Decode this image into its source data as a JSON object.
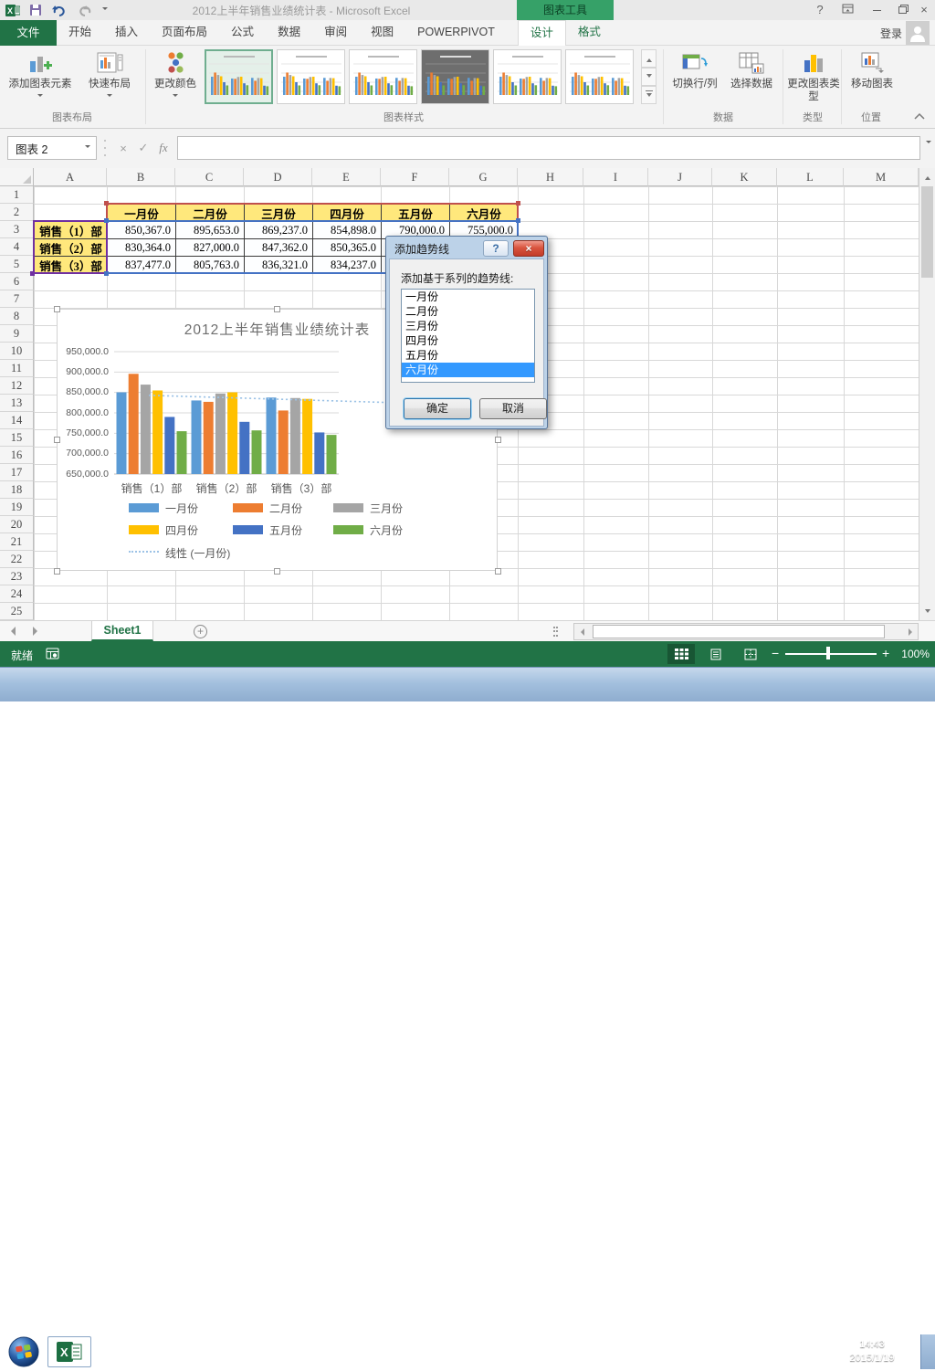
{
  "window": {
    "title": "2012上半年销售业绩统计表 - Microsoft Excel",
    "context_group": "图表工具",
    "sign_in": "登录",
    "help_glyph": "?",
    "close_glyph": "×"
  },
  "tabs": {
    "file": "文件",
    "items": [
      "开始",
      "插入",
      "页面布局",
      "公式",
      "数据",
      "审阅",
      "视图",
      "POWERPIVOT"
    ],
    "contextual": [
      "设计",
      "格式"
    ],
    "active": "设计"
  },
  "ribbon": {
    "buttons": {
      "add_chart_element": "添加图表元素",
      "quick_layout": "快速布局",
      "change_colors": "更改颜色",
      "switch_row_col": "切换行/列",
      "select_data": "选择数据",
      "change_chart_type": "更改图表类型",
      "move_chart": "移动图表"
    },
    "group_labels": {
      "chart_layouts": "图表布局",
      "chart_styles": "图表样式",
      "data": "数据",
      "type": "类型",
      "location": "位置"
    },
    "style_thumbnail_count": 6,
    "selected_thumbnail": 1,
    "dark_thumbnail": 4
  },
  "formula_bar": {
    "name_box": "图表 2",
    "fx": "fx",
    "cancel": "×",
    "enter": "✓"
  },
  "sheet": {
    "columns": [
      "A",
      "B",
      "C",
      "D",
      "E",
      "F",
      "G",
      "H",
      "I",
      "J",
      "K",
      "L",
      "M"
    ],
    "row_count": 25,
    "table_title": "2012上半年销售业绩统计表",
    "month_headers": [
      "一月份",
      "二月份",
      "三月份",
      "四月份",
      "五月份",
      "六月份"
    ],
    "dept_labels": [
      "销售（1）部",
      "销售（2）部",
      "销售（3）部"
    ],
    "active_sheet_tab": "Sheet1",
    "add_sheet_glyph": "+"
  },
  "chart_data": {
    "type": "bar",
    "title": "2012上半年销售业绩统计表",
    "categories": [
      "销售（1）部",
      "销售（2）部",
      "销售（3）部"
    ],
    "series": [
      {
        "name": "一月份",
        "color": "#5B9BD5",
        "values": [
          850367,
          830364,
          837477
        ]
      },
      {
        "name": "二月份",
        "color": "#ED7D31",
        "values": [
          895653,
          827000,
          805763
        ]
      },
      {
        "name": "三月份",
        "color": "#A5A5A5",
        "values": [
          869237,
          847362,
          836321
        ]
      },
      {
        "name": "四月份",
        "color": "#FFC000",
        "values": [
          854898,
          850365,
          834237
        ]
      },
      {
        "name": "五月份",
        "color": "#4472C4",
        "values": [
          790000,
          778000,
          752000
        ]
      },
      {
        "name": "六月份",
        "color": "#70AD47",
        "values": [
          755000,
          757000,
          746000
        ]
      }
    ],
    "trendline": {
      "name": "线性 (一月份)",
      "color": "#9DC3E6",
      "style": "dotted",
      "start_value": 843000,
      "end_value": 825000
    },
    "ylim": [
      650000,
      950000
    ],
    "ytick_step": 50000,
    "ytick_labels": [
      "950,000.0",
      "900,000.0",
      "850,000.0",
      "800,000.0",
      "750,000.0",
      "700,000.0",
      "650,000.0"
    ],
    "grid": true,
    "legend_position": "bottom",
    "value_format": "#,##0.0"
  },
  "dialog": {
    "title": "添加趋势线",
    "help_glyph": "?",
    "close_glyph": "×",
    "label": "添加基于系列的趋势线:",
    "items": [
      "一月份",
      "二月份",
      "三月份",
      "四月份",
      "五月份",
      "六月份"
    ],
    "selected_index": 5,
    "ok_label": "确定",
    "cancel_label": "取消"
  },
  "status_bar": {
    "ready": "就绪",
    "zoom_level": "100%"
  },
  "taskbar": {
    "time": "14:43",
    "date": "2015/1/19"
  },
  "colors": {
    "excel_green": "#217346",
    "list_selection": "#3399FF",
    "cell_fill_yellow": "#FFE87C"
  }
}
